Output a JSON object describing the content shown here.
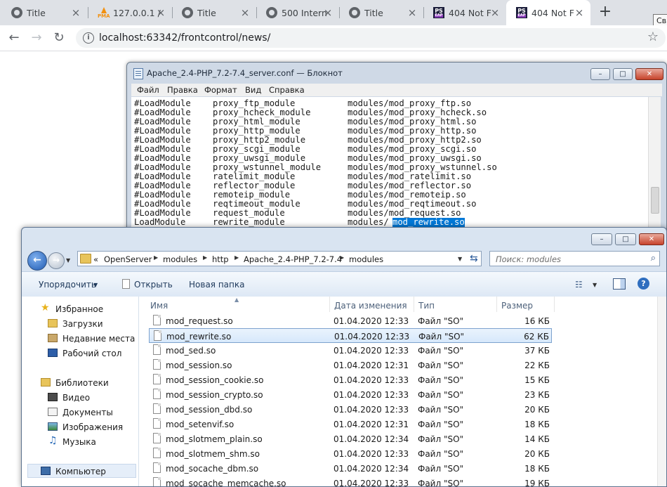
{
  "browser": {
    "tabs": [
      {
        "label": "Title",
        "icon": "globe-icon"
      },
      {
        "label": "127.0.0.1 / ",
        "icon": "phpmyadmin-icon"
      },
      {
        "label": "Title",
        "icon": "globe-icon"
      },
      {
        "label": "500 Intern",
        "icon": "globe-icon"
      },
      {
        "label": "Title",
        "icon": "globe-icon"
      },
      {
        "label": "404 Not F",
        "icon": "phpstorm-icon"
      },
      {
        "label": "404 Not F",
        "icon": "phpstorm-icon",
        "active": true
      }
    ],
    "new_tab": "+",
    "url": "localhost:63342/frontcontrol/news/",
    "tooltip": "Св"
  },
  "notepad": {
    "title": "Apache_2.4-PHP_7.2-7.4_server.conf — Блокнот",
    "menu": [
      "Файл",
      "Правка",
      "Формат",
      "Вид",
      "Справка"
    ],
    "lines": [
      [
        "#LoadModule",
        "proxy_ftp_module",
        "modules/mod_proxy_ftp.so"
      ],
      [
        "#LoadModule",
        "proxy_hcheck_module",
        "modules/mod_proxy_hcheck.so"
      ],
      [
        "#LoadModule",
        "proxy_html_module",
        "modules/mod_proxy_html.so"
      ],
      [
        "#LoadModule",
        "proxy_http_module",
        "modules/mod_proxy_http.so"
      ],
      [
        "#LoadModule",
        "proxy_http2_module",
        "modules/mod_proxy_http2.so"
      ],
      [
        "#LoadModule",
        "proxy_scgi_module",
        "modules/mod_proxy_scgi.so"
      ],
      [
        "#LoadModule",
        "proxy_uwsgi_module",
        "modules/mod_proxy_uwsgi.so"
      ],
      [
        "#LoadModule",
        "proxy_wstunnel_module",
        "modules/mod_proxy_wstunnel.so"
      ],
      [
        "#LoadModule",
        "ratelimit_module",
        "modules/mod_ratelimit.so"
      ],
      [
        "#LoadModule",
        "reflector_module",
        "modules/mod_reflector.so"
      ],
      [
        "#LoadModule",
        "remoteip_module",
        "modules/mod_remoteip.so"
      ],
      [
        "#LoadModule",
        "reqtimeout_module",
        "modules/mod_reqtimeout.so"
      ],
      [
        "#LoadModule",
        "request_module",
        "modules/mod_request.so"
      ],
      [
        "LoadModule",
        "rewrite_module",
        "modules/"
      ]
    ],
    "selected_text": "mod_rewrite.so"
  },
  "explorer": {
    "breadcrumb": [
      "OpenServer",
      "modules",
      "http",
      "Apache_2.4-PHP_7.2-7.4",
      "modules"
    ],
    "breadcrumb_prefix": "«",
    "search_placeholder": "Поиск: modules",
    "commands": [
      "Упорядочить",
      "Открыть",
      "Новая папка"
    ],
    "nav": {
      "favorites": "Избранное",
      "downloads": "Загрузки",
      "recent": "Недавние места",
      "desktop": "Рабочий стол",
      "libraries": "Библиотеки",
      "video": "Видео",
      "documents": "Документы",
      "images": "Изображения",
      "music": "Музыка",
      "computer": "Компьютер"
    },
    "columns": [
      "Имя",
      "Дата изменения",
      "Тип",
      "Размер"
    ],
    "files": [
      {
        "name": "mod_request.so",
        "date": "01.04.2020 12:33",
        "type": "Файл \"SO\"",
        "size": "16 КБ"
      },
      {
        "name": "mod_rewrite.so",
        "date": "01.04.2020 12:33",
        "type": "Файл \"SO\"",
        "size": "62 КБ",
        "selected": true
      },
      {
        "name": "mod_sed.so",
        "date": "01.04.2020 12:33",
        "type": "Файл \"SO\"",
        "size": "37 КБ"
      },
      {
        "name": "mod_session.so",
        "date": "01.04.2020 12:31",
        "type": "Файл \"SO\"",
        "size": "22 КБ"
      },
      {
        "name": "mod_session_cookie.so",
        "date": "01.04.2020 12:33",
        "type": "Файл \"SO\"",
        "size": "15 КБ"
      },
      {
        "name": "mod_session_crypto.so",
        "date": "01.04.2020 12:33",
        "type": "Файл \"SO\"",
        "size": "23 КБ"
      },
      {
        "name": "mod_session_dbd.so",
        "date": "01.04.2020 12:33",
        "type": "Файл \"SO\"",
        "size": "20 КБ"
      },
      {
        "name": "mod_setenvif.so",
        "date": "01.04.2020 12:31",
        "type": "Файл \"SO\"",
        "size": "18 КБ"
      },
      {
        "name": "mod_slotmem_plain.so",
        "date": "01.04.2020 12:34",
        "type": "Файл \"SO\"",
        "size": "14 КБ"
      },
      {
        "name": "mod_slotmem_shm.so",
        "date": "01.04.2020 12:33",
        "type": "Файл \"SO\"",
        "size": "20 КБ"
      },
      {
        "name": "mod_socache_dbm.so",
        "date": "01.04.2020 12:34",
        "type": "Файл \"SO\"",
        "size": "18 КБ"
      },
      {
        "name": "mod_socache_memcache.so",
        "date": "01.04.2020 12:33",
        "type": "Файл \"SO\"",
        "size": "19 КБ"
      }
    ]
  }
}
